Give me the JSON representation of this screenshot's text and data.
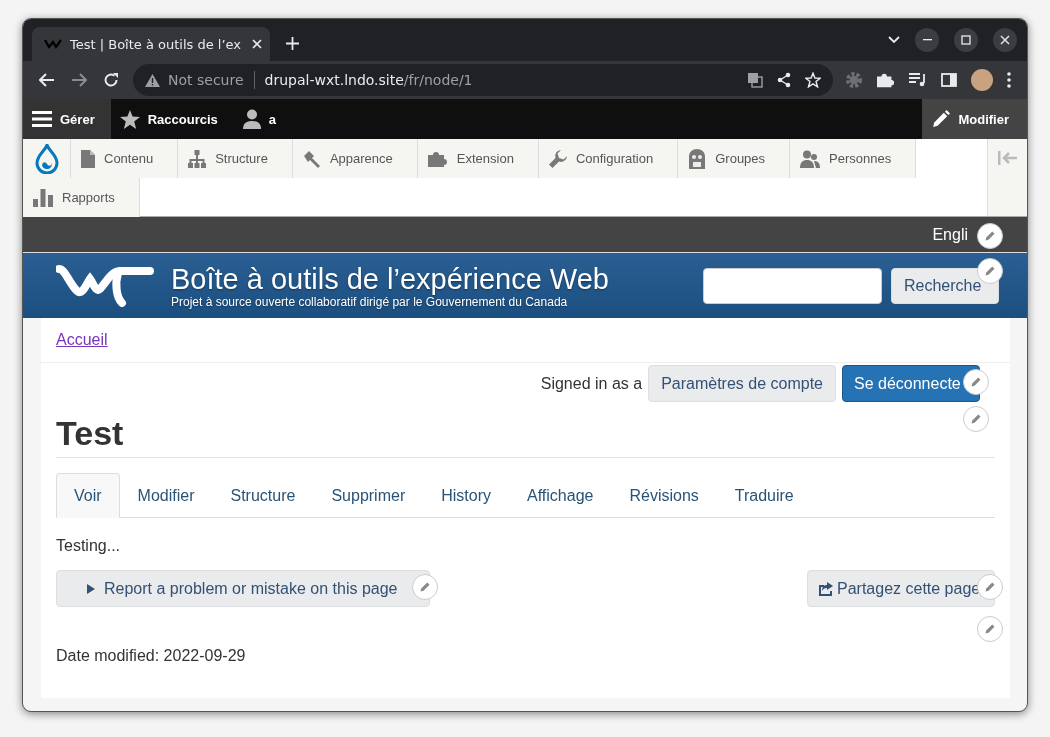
{
  "browser": {
    "tab_title": "Test | Boîte à outils de l’ex",
    "security": "Not secure",
    "url_host": "drupal-wxt.lndo.site",
    "url_path": "/fr/node/1"
  },
  "admin_toolbar": {
    "items": [
      {
        "label": "Gérer",
        "selected": true
      },
      {
        "label": "Raccourcis",
        "selected": false
      },
      {
        "label": "a",
        "selected": false
      }
    ],
    "edit_button": "Modifier"
  },
  "tray": {
    "items": [
      {
        "label": "Contenu"
      },
      {
        "label": "Structure"
      },
      {
        "label": "Apparence"
      },
      {
        "label": "Extension"
      },
      {
        "label": "Configuration"
      },
      {
        "label": "Groupes"
      },
      {
        "label": "Personnes"
      },
      {
        "label": "Rapports"
      }
    ]
  },
  "language_link": "Engli",
  "site_header": {
    "title": "Boîte à outils de l’expérience Web",
    "subtitle": "Projet à source ouverte collaboratif dirigé par le Gouvernement du Canada",
    "search_button": "Recherche"
  },
  "breadcrumb": [
    "Accueil"
  ],
  "account": {
    "signed_in_text": "Signed in as a",
    "buttons": [
      {
        "label": "Paramètres de compte",
        "kind": "default"
      },
      {
        "label": "Se déconnecte",
        "kind": "primary"
      }
    ]
  },
  "page_title": "Test",
  "tabs": [
    {
      "label": "Voir",
      "selected": true
    },
    {
      "label": "Modifier",
      "selected": false
    },
    {
      "label": "Structure",
      "selected": false
    },
    {
      "label": "Supprimer",
      "selected": false
    },
    {
      "label": "History",
      "selected": false
    },
    {
      "label": "Affichage",
      "selected": false
    },
    {
      "label": "Révisions",
      "selected": false
    },
    {
      "label": "Traduire",
      "selected": false
    }
  ],
  "body_text": "Testing...",
  "report_button": "Report a problem or mistake on this page",
  "share_button": "Partagez cette page",
  "date_modified": "Date modified: 2022-09-29"
}
